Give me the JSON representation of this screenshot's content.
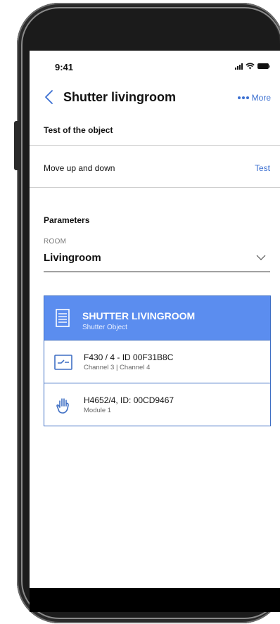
{
  "status_bar": {
    "time": "9:41"
  },
  "nav": {
    "title": "Shutter livingroom",
    "more_label": "More"
  },
  "test_section": {
    "title": "Test of the object",
    "row_label": "Move up and down",
    "row_action": "Test"
  },
  "parameters": {
    "title": "Parameters",
    "room_label": "ROOM",
    "room_value": "Livingroom"
  },
  "card": {
    "title": "SHUTTER LIVINGROOM",
    "subtitle": "Shutter Object",
    "rows": [
      {
        "title": "F430 / 4 - ID 00F31B8C",
        "subtitle": "Channel 3 | Channel 4",
        "icon": "switch-icon"
      },
      {
        "title": "H4652/4, ID: 00CD9467",
        "subtitle": "Module 1",
        "icon": "hand-icon"
      }
    ]
  },
  "colors": {
    "accent": "#3b6fd1",
    "card_header": "#5b8def",
    "card_border": "#3f6fc4"
  }
}
